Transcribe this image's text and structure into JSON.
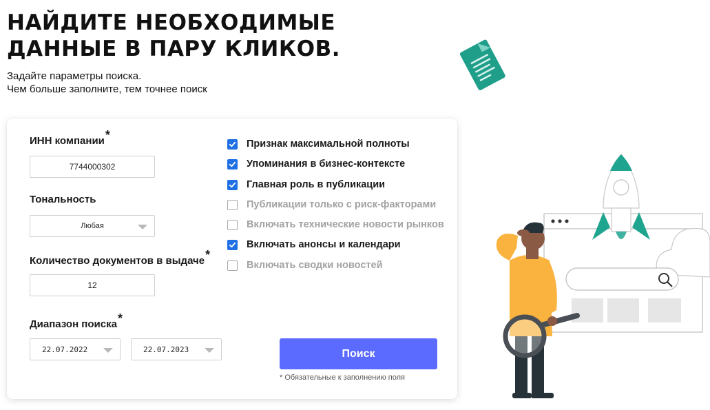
{
  "hero": {
    "title_line1": "Найдите необходимые",
    "title_line2": "данные в пару кликов.",
    "subtitle_line1": "Задайте параметры поиска.",
    "subtitle_line2": "Чем больше заполните, тем точнее поиск"
  },
  "form": {
    "inn_label": "ИНН компании",
    "inn_value": "7744000302",
    "tone_label": "Тональность",
    "tone_value": "Любая",
    "count_label": "Количество документов в выдаче",
    "count_value": "12",
    "range_label": "Диапазон поиска",
    "date_from": "22.07.2022",
    "date_to": "22.07.2023",
    "required_mark": "*",
    "search_button": "Поиск",
    "required_note": "* Обязательные к заполнению поля"
  },
  "options": [
    {
      "label": "Признак максимальной полноты",
      "checked": true
    },
    {
      "label": "Упоминания в бизнес-контексте",
      "checked": true
    },
    {
      "label": "Главная роль в публикации",
      "checked": true
    },
    {
      "label": "Публикации только с риск-факторами",
      "checked": false
    },
    {
      "label": "Включать технические новости рынков",
      "checked": false
    },
    {
      "label": "Включать анонсы и календари",
      "checked": true
    },
    {
      "label": "Включать сводки новостей",
      "checked": false
    }
  ],
  "colors": {
    "accent": "#5b6bff",
    "checkbox": "#1f6fe5",
    "teal": "#1fa58f",
    "shirt": "#f9b33e"
  },
  "icons": {
    "check": "check-icon",
    "dropdown": "chevron-down-icon",
    "magnifier": "search-icon"
  }
}
